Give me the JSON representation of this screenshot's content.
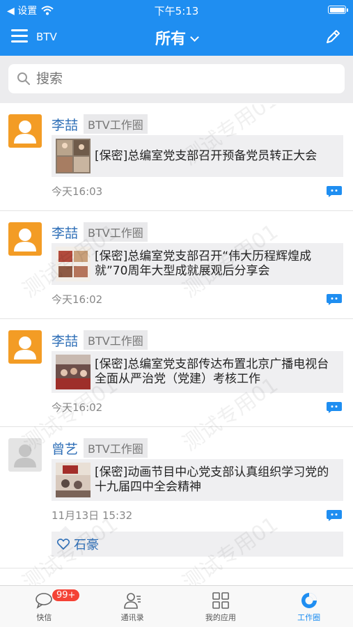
{
  "status_bar": {
    "back_label": "设置",
    "time": "下午5:13"
  },
  "nav": {
    "brand": "BTV",
    "title": "所有"
  },
  "search": {
    "placeholder": "搜索"
  },
  "watermark": "测试专用01",
  "posts": [
    {
      "author": "李喆",
      "circle": "BTV工作圈",
      "title": "[保密]总编室党支部召开预备党员转正大会",
      "time": "今天16:03",
      "avatar_color": "orange"
    },
    {
      "author": "李喆",
      "circle": "BTV工作圈",
      "title": "[保密]总编室党支部召开“伟大历程辉煌成就”70周年大型成就展观后分享会",
      "time": "今天16:02",
      "avatar_color": "orange"
    },
    {
      "author": "李喆",
      "circle": "BTV工作圈",
      "title": "[保密]总编室党支部传达布置北京广播电视台全面从严治党（党建）考核工作",
      "time": "今天16:02",
      "avatar_color": "orange"
    },
    {
      "author": "曾艺",
      "circle": "BTV工作圈",
      "title": "[保密]动画节目中心党支部认真组织学习党的十九届四中全会精神",
      "time": "11月13日 15:32",
      "avatar_color": "gray",
      "like": "石豪"
    }
  ],
  "tabs": [
    {
      "label": "快信",
      "badge": "99+",
      "icon": "chat-icon"
    },
    {
      "label": "通讯录",
      "icon": "contacts-icon"
    },
    {
      "label": "我的应用",
      "icon": "apps-grid-icon"
    },
    {
      "label": "工作圈",
      "icon": "work-circle-icon",
      "active": true
    }
  ],
  "colors": {
    "primary": "#1f8ef1",
    "author": "#2f6fb7",
    "badge": "#f44336",
    "avatar_orange": "#f39c25"
  }
}
